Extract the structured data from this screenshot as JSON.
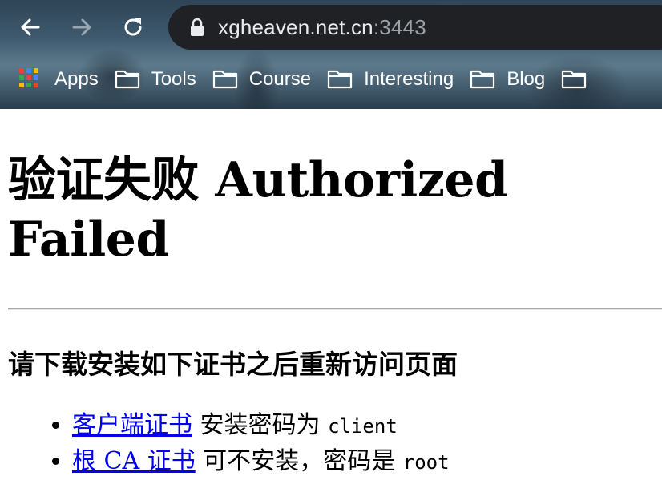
{
  "browser": {
    "url_host": "xgheaven.net.cn",
    "url_port": ":3443",
    "bookmarks": [
      {
        "label": "Apps",
        "icon": "apps-grid-icon"
      },
      {
        "label": "Tools",
        "icon": "folder-icon"
      },
      {
        "label": "Course",
        "icon": "folder-icon"
      },
      {
        "label": "Interesting",
        "icon": "folder-icon"
      },
      {
        "label": "Blog",
        "icon": "folder-icon"
      },
      {
        "label": "",
        "icon": "folder-icon"
      }
    ]
  },
  "page": {
    "title": "验证失败 Authorized Failed",
    "subtitle": "请下载安装如下证书之后重新访问页面",
    "items": [
      {
        "link": "客户端证书",
        "text": " 安装密码为 ",
        "code": "client"
      },
      {
        "link": "根 CA 证书",
        "text": " 可不安装，密码是 ",
        "code": "root"
      }
    ]
  },
  "colors": {
    "link": "#0000ee",
    "omnibox": "#202124"
  }
}
